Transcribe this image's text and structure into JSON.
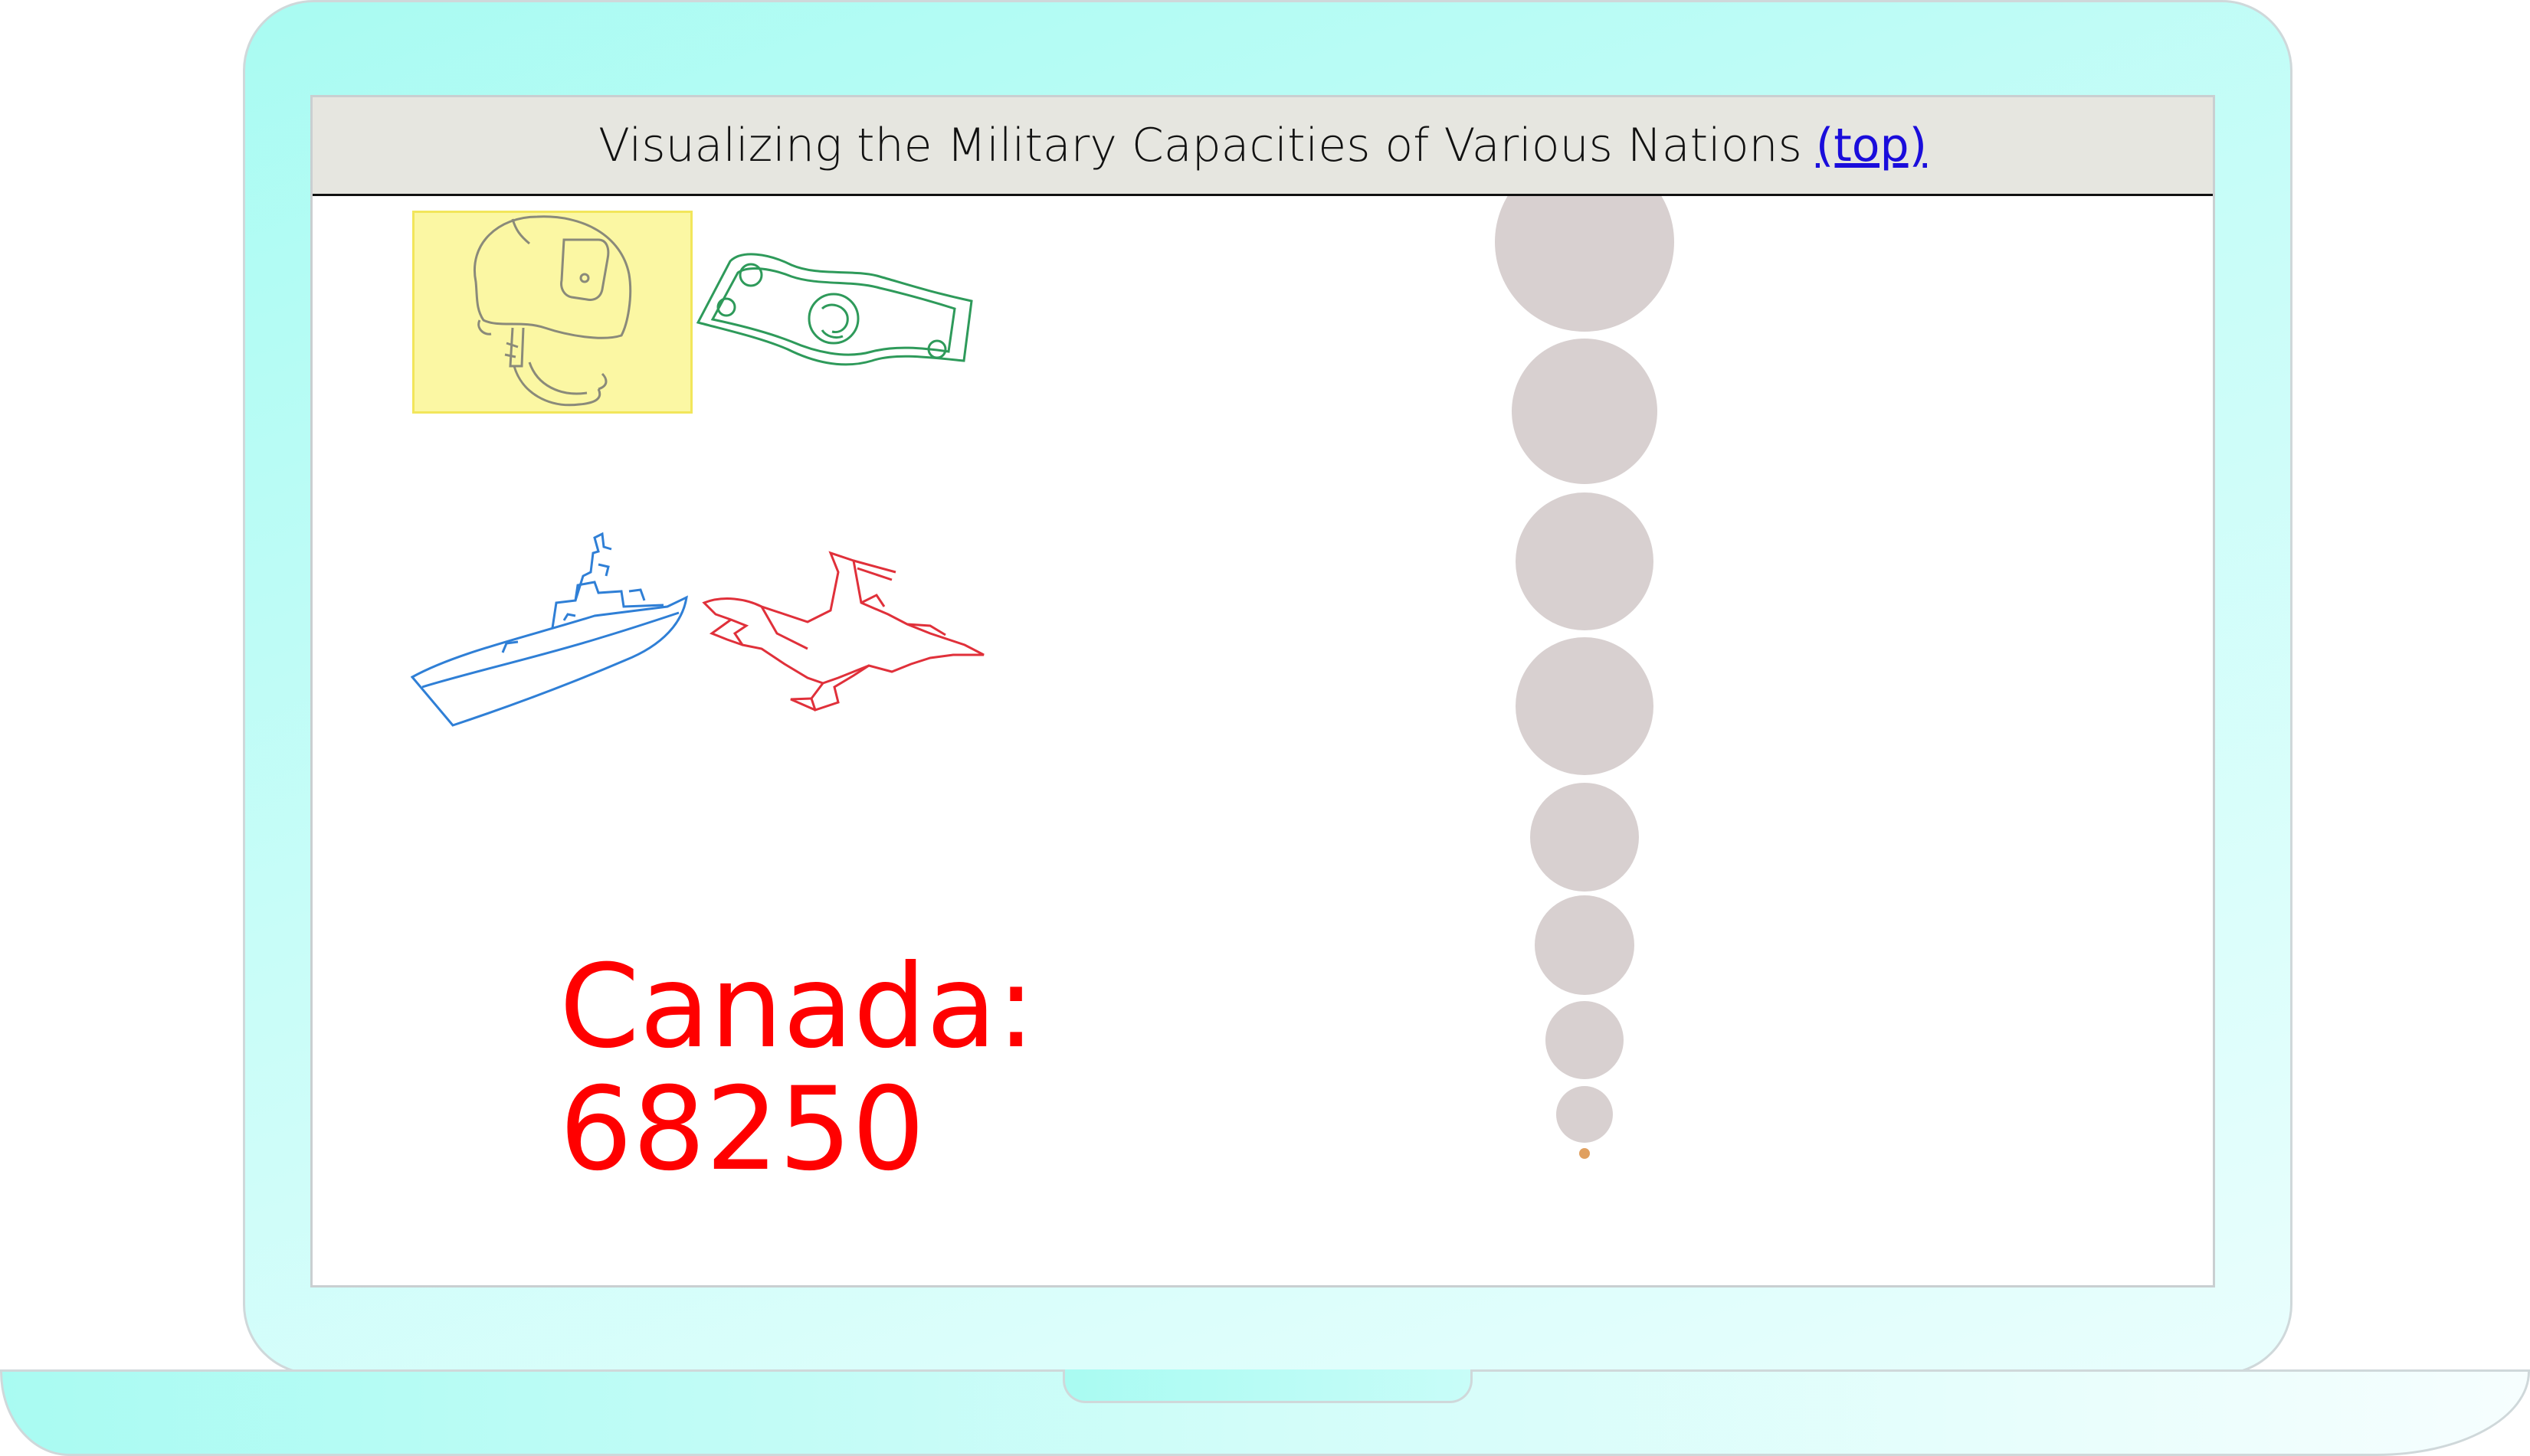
{
  "header": {
    "title": "Visualizing the Military Capacities of Various Nations",
    "top_link": "(top)"
  },
  "icons": [
    {
      "name": "helmet",
      "color": "#8a8a7a",
      "selected": true
    },
    {
      "name": "money",
      "color": "#2e9a5a",
      "selected": false
    },
    {
      "name": "warship",
      "color": "#2f7fd6",
      "selected": false
    },
    {
      "name": "fighter-jet",
      "color": "#e0303a",
      "selected": false
    }
  ],
  "selection": {
    "country": "Canada:",
    "value": "68250",
    "color": "#ff0000"
  },
  "bubble_chart": {
    "bubble_color": "#d8d0d0",
    "highlight_color": "#e0a060",
    "highlighted_index": 8
  },
  "colors": {
    "title_bar": "#e6e6e0",
    "link": "#1a0ddb",
    "helmet_highlight": "#fbf7a3"
  }
}
